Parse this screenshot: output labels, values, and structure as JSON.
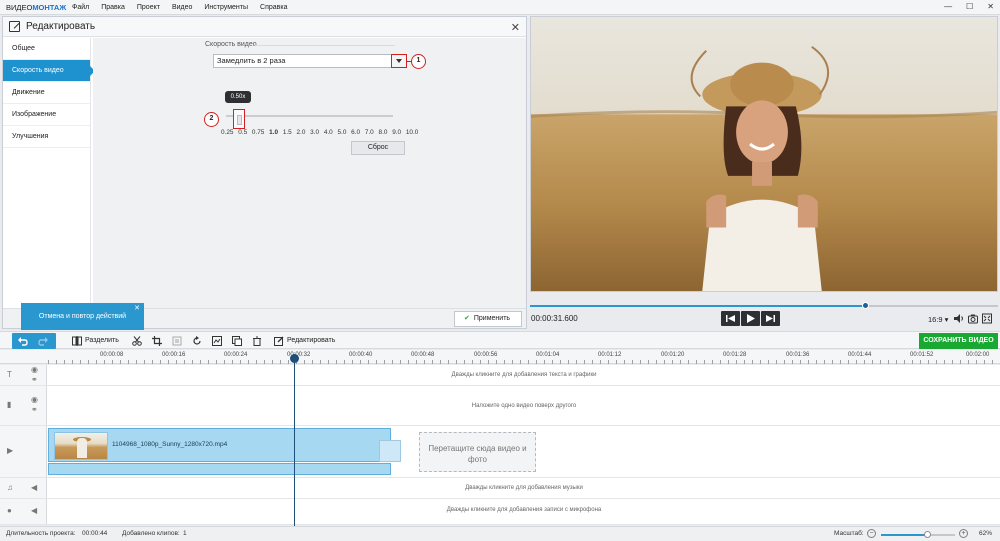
{
  "app": {
    "logo_part1": "ВИДЕО",
    "logo_part2": "МОНТАЖ",
    "menu": [
      "Файл",
      "Правка",
      "Проект",
      "Видео",
      "Инструменты",
      "Справка"
    ],
    "window_buttons": [
      "—",
      "☐",
      "✕"
    ]
  },
  "edit_panel": {
    "title": "Редактировать",
    "close": "✕",
    "sidebar": [
      {
        "label": "Общее",
        "active": false
      },
      {
        "label": "Скорость видео",
        "active": true
      },
      {
        "label": "Движение",
        "active": false
      },
      {
        "label": "Изображение",
        "active": false
      },
      {
        "label": "Улучшения",
        "active": false
      }
    ],
    "speed_section_label": "Скорость видео",
    "speed_select_value": "Замедлить в 2 раза",
    "badge_1": "1",
    "badge_2": "2",
    "slider_tooltip": "0.50x",
    "slider_value": 0.5,
    "slider_ticks": [
      "0.25",
      "0.5",
      "0.75",
      "1.0",
      "1.5",
      "2.0",
      "3.0",
      "4.0",
      "5.0",
      "6.0",
      "7.0",
      "8.0",
      "9.0",
      "10.0"
    ],
    "slider_ticks_bold_index": 3,
    "reset_label": "Сброс",
    "apply_label": "Применить"
  },
  "help_tip": {
    "text": "Отмена и повтор действий",
    "close": "✕"
  },
  "preview": {
    "timecode": "00:00:31.600",
    "progress": 0.715,
    "aspect_ratio": "16:9 ▾"
  },
  "toolbar": {
    "split_label": "Разделить",
    "edit_label": "Редактировать",
    "save_label": "СОХРАНИТЬ ВИДЕО"
  },
  "ruler": {
    "labels": [
      "00:00:08",
      "00:00:16",
      "00:00:24",
      "00:00:32",
      "00:00:40",
      "00:00:48",
      "00:00:56",
      "00:01:04",
      "00:01:12",
      "00:01:20",
      "00:01:28",
      "00:01:36",
      "00:01:44",
      "00:01:52",
      "00:02:00"
    ]
  },
  "tracks": {
    "text_hint": "Дважды кликните для добавления текста и графики",
    "overlay_hint": "Наложите одно видео поверх другого",
    "clip_name": "1104968_1080p_Sunny_1280x720.mp4",
    "drop_zone": "Перетащите сюда видео и фото",
    "music_hint": "Дважды кликните для добавления музыки",
    "mic_hint": "Дважды кликните для добавления записи с микрофона"
  },
  "statusbar": {
    "duration_label": "Длительность проекта:",
    "duration_value": "00:00:44",
    "clips_label": "Добавлено клипов:",
    "clips_value": "1",
    "zoom_label": "Масштаб:",
    "zoom_value": "62%",
    "zoom_level": 0.62
  },
  "colors": {
    "accent": "#1e92cf",
    "save": "#19a832",
    "annotation": "#d42020"
  }
}
